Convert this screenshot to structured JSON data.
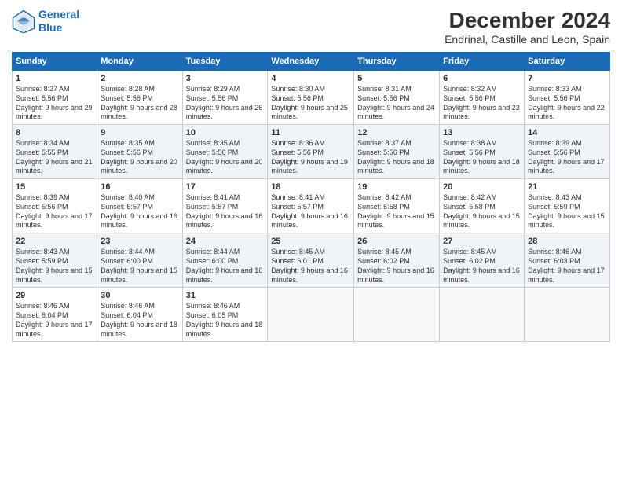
{
  "logo": {
    "line1": "General",
    "line2": "Blue"
  },
  "title": "December 2024",
  "subtitle": "Endrinal, Castille and Leon, Spain",
  "weekdays": [
    "Sunday",
    "Monday",
    "Tuesday",
    "Wednesday",
    "Thursday",
    "Friday",
    "Saturday"
  ],
  "weeks": [
    [
      {
        "day": "1",
        "rise": "8:27 AM",
        "set": "5:56 PM",
        "daylight": "9 hours and 29 minutes."
      },
      {
        "day": "2",
        "rise": "8:28 AM",
        "set": "5:56 PM",
        "daylight": "9 hours and 28 minutes."
      },
      {
        "day": "3",
        "rise": "8:29 AM",
        "set": "5:56 PM",
        "daylight": "9 hours and 26 minutes."
      },
      {
        "day": "4",
        "rise": "8:30 AM",
        "set": "5:56 PM",
        "daylight": "9 hours and 25 minutes."
      },
      {
        "day": "5",
        "rise": "8:31 AM",
        "set": "5:56 PM",
        "daylight": "9 hours and 24 minutes."
      },
      {
        "day": "6",
        "rise": "8:32 AM",
        "set": "5:56 PM",
        "daylight": "9 hours and 23 minutes."
      },
      {
        "day": "7",
        "rise": "8:33 AM",
        "set": "5:56 PM",
        "daylight": "9 hours and 22 minutes."
      }
    ],
    [
      {
        "day": "8",
        "rise": "8:34 AM",
        "set": "5:55 PM",
        "daylight": "9 hours and 21 minutes."
      },
      {
        "day": "9",
        "rise": "8:35 AM",
        "set": "5:56 PM",
        "daylight": "9 hours and 20 minutes."
      },
      {
        "day": "10",
        "rise": "8:35 AM",
        "set": "5:56 PM",
        "daylight": "9 hours and 20 minutes."
      },
      {
        "day": "11",
        "rise": "8:36 AM",
        "set": "5:56 PM",
        "daylight": "9 hours and 19 minutes."
      },
      {
        "day": "12",
        "rise": "8:37 AM",
        "set": "5:56 PM",
        "daylight": "9 hours and 18 minutes."
      },
      {
        "day": "13",
        "rise": "8:38 AM",
        "set": "5:56 PM",
        "daylight": "9 hours and 18 minutes."
      },
      {
        "day": "14",
        "rise": "8:39 AM",
        "set": "5:56 PM",
        "daylight": "9 hours and 17 minutes."
      }
    ],
    [
      {
        "day": "15",
        "rise": "8:39 AM",
        "set": "5:56 PM",
        "daylight": "9 hours and 17 minutes."
      },
      {
        "day": "16",
        "rise": "8:40 AM",
        "set": "5:57 PM",
        "daylight": "9 hours and 16 minutes."
      },
      {
        "day": "17",
        "rise": "8:41 AM",
        "set": "5:57 PM",
        "daylight": "9 hours and 16 minutes."
      },
      {
        "day": "18",
        "rise": "8:41 AM",
        "set": "5:57 PM",
        "daylight": "9 hours and 16 minutes."
      },
      {
        "day": "19",
        "rise": "8:42 AM",
        "set": "5:58 PM",
        "daylight": "9 hours and 15 minutes."
      },
      {
        "day": "20",
        "rise": "8:42 AM",
        "set": "5:58 PM",
        "daylight": "9 hours and 15 minutes."
      },
      {
        "day": "21",
        "rise": "8:43 AM",
        "set": "5:59 PM",
        "daylight": "9 hours and 15 minutes."
      }
    ],
    [
      {
        "day": "22",
        "rise": "8:43 AM",
        "set": "5:59 PM",
        "daylight": "9 hours and 15 minutes."
      },
      {
        "day": "23",
        "rise": "8:44 AM",
        "set": "6:00 PM",
        "daylight": "9 hours and 15 minutes."
      },
      {
        "day": "24",
        "rise": "8:44 AM",
        "set": "6:00 PM",
        "daylight": "9 hours and 16 minutes."
      },
      {
        "day": "25",
        "rise": "8:45 AM",
        "set": "6:01 PM",
        "daylight": "9 hours and 16 minutes."
      },
      {
        "day": "26",
        "rise": "8:45 AM",
        "set": "6:02 PM",
        "daylight": "9 hours and 16 minutes."
      },
      {
        "day": "27",
        "rise": "8:45 AM",
        "set": "6:02 PM",
        "daylight": "9 hours and 16 minutes."
      },
      {
        "day": "28",
        "rise": "8:46 AM",
        "set": "6:03 PM",
        "daylight": "9 hours and 17 minutes."
      }
    ],
    [
      {
        "day": "29",
        "rise": "8:46 AM",
        "set": "6:04 PM",
        "daylight": "9 hours and 17 minutes."
      },
      {
        "day": "30",
        "rise": "8:46 AM",
        "set": "6:04 PM",
        "daylight": "9 hours and 18 minutes."
      },
      {
        "day": "31",
        "rise": "8:46 AM",
        "set": "6:05 PM",
        "daylight": "9 hours and 18 minutes."
      },
      null,
      null,
      null,
      null
    ]
  ]
}
